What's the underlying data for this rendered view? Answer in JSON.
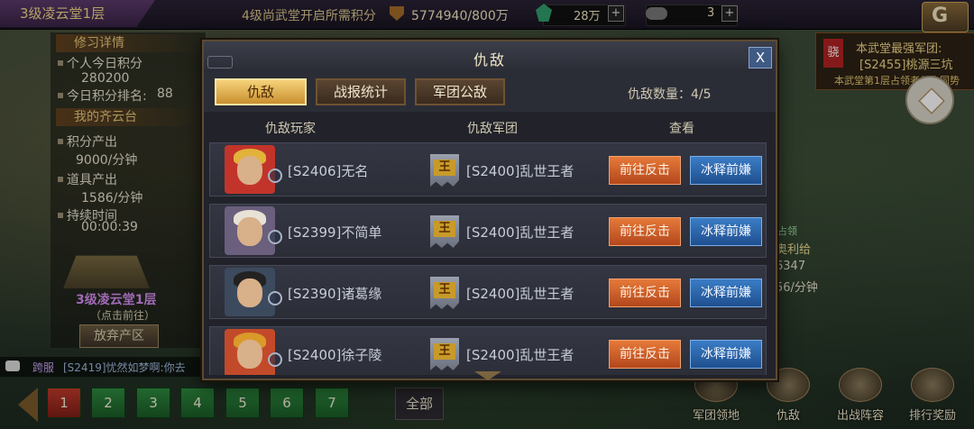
{
  "topbar": {
    "level_title": "3级凌云堂1层",
    "points_label": "4级尚武堂开启所需积分",
    "points_value": "5774940/800万",
    "jade_value": "28万",
    "cloud_value": "3",
    "plus": "+",
    "back_label": "G"
  },
  "left_panel": {
    "section1_title": "修习详情",
    "personal_today_label": "个人今日积分",
    "personal_today_value": "280200",
    "rank_label": "今日积分排名:",
    "rank_value": "88",
    "section2_title": "我的齐云台",
    "points_output_label": "积分产出",
    "points_output_value": "9000/分钟",
    "item_output_label": "道具产出",
    "item_output_value": "1586/分钟",
    "duration_label": "持续时间",
    "duration_value": "00:00:39",
    "tower_name": "3级凌云堂1层",
    "tower_sub": "（点击前往）",
    "abandon_label": "放弃产区"
  },
  "chat": {
    "tag": "跨服",
    "text": "[S2419]忧然如梦啊:你去"
  },
  "pager": {
    "pages": [
      "1",
      "2",
      "3",
      "4",
      "5",
      "6",
      "7"
    ],
    "active_index": 0,
    "all_label": "全部"
  },
  "right_panel": {
    "badge": "骁",
    "line1": "本武堂最强军团:",
    "line2": "[S2455]桃源三坑",
    "line3": "本武堂第1层占领者与你同势",
    "frag1": "占领",
    "frag2": "奥利给",
    "frag3": "6347",
    "frag4": "56/分钟"
  },
  "bottom_nav": [
    {
      "label": "军团领地",
      "icon": "legion-territory-icon"
    },
    {
      "label": "仇敌",
      "icon": "enemy-icon"
    },
    {
      "label": "出战阵容",
      "icon": "formation-icon"
    },
    {
      "label": "排行奖励",
      "icon": "ranking-reward-icon"
    }
  ],
  "modal": {
    "title": "仇敌",
    "close": "X",
    "tabs": [
      "仇敌",
      "战报统计",
      "军团公敌"
    ],
    "active_tab": 0,
    "count_label": "仇敌数量：4/5",
    "columns": [
      "仇敌玩家",
      "仇敌军团",
      "查看"
    ],
    "legion_glyph": "王",
    "rows": [
      {
        "player": "[S2406]无名",
        "legion": "[S2400]乱世王者",
        "attack": "前往反击",
        "forgive": "冰释前嫌",
        "avatar_bg": "#c2342a",
        "hair": "#e2b23a"
      },
      {
        "player": "[S2399]不简单",
        "legion": "[S2400]乱世王者",
        "attack": "前往反击",
        "forgive": "冰释前嫌",
        "avatar_bg": "#6a5f7d",
        "hair": "#e8e2d6"
      },
      {
        "player": "[S2390]诸葛缘",
        "legion": "[S2400]乱世王者",
        "attack": "前往反击",
        "forgive": "冰释前嫌",
        "avatar_bg": "#3c4a5e",
        "hair": "#222"
      },
      {
        "player": "[S2400]徐子陵",
        "legion": "[S2400]乱世王者",
        "attack": "前往反击",
        "forgive": "冰释前嫌",
        "avatar_bg": "#c24a2a",
        "hair": "#d99a2a"
      }
    ]
  }
}
